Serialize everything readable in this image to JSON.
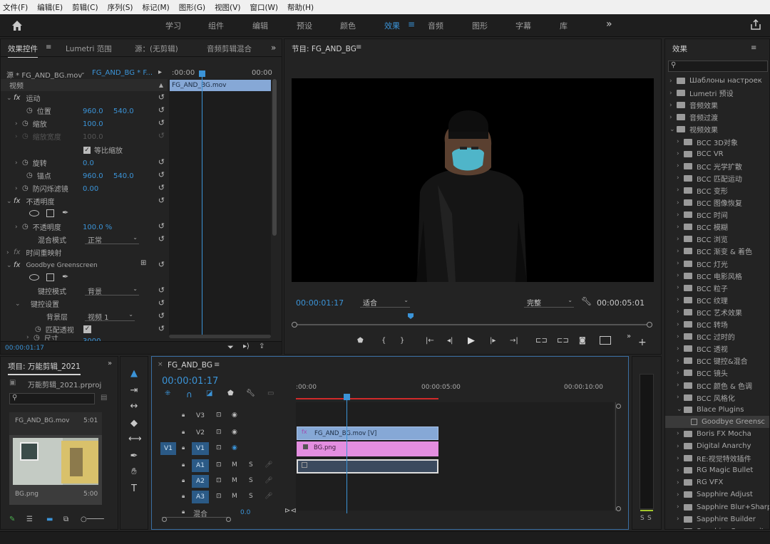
{
  "menu": [
    "文件(F)",
    "编辑(E)",
    "剪辑(C)",
    "序列(S)",
    "标记(M)",
    "图形(G)",
    "视图(V)",
    "窗口(W)",
    "帮助(H)"
  ],
  "workspaces": [
    "学习",
    "组件",
    "编辑",
    "预设",
    "颜色",
    "效果",
    "音频",
    "图形",
    "字幕",
    "库"
  ],
  "active_workspace": "效果",
  "effect_controls": {
    "tabs": [
      "效果控件",
      "Lumetri 范围",
      "源：(无剪辑)",
      "音频剪辑混合"
    ],
    "source_label": "源 * FG_AND_BG.mov",
    "seq_label": "FG_AND_BG * F...",
    "ruler_start": ":00:00",
    "ruler_end": "00:00",
    "clip_bar": "FG_AND_BG.mov",
    "video_label": "视频",
    "motion": "运动",
    "position": "位置",
    "pos_x": "960.0",
    "pos_y": "540.0",
    "scale": "缩放",
    "scale_val": "100.0",
    "scale_width": "缩放宽度",
    "scale_width_val": "100.0",
    "uniform_scale": "等比缩放",
    "rotation": "旋转",
    "rotation_val": "0.0",
    "anchor": "锚点",
    "anchor_x": "960.0",
    "anchor_y": "540.0",
    "anti_flicker": "防闪烁滤镜",
    "anti_flicker_val": "0.00",
    "opacity_section": "不透明度",
    "opacity": "不透明度",
    "opacity_val": "100.0 %",
    "blend_mode": "混合模式",
    "blend_val": "正常",
    "time_remap": "时间重映射",
    "goodbye": "Goodbye Greenscreen",
    "key_mode": "键控模式",
    "key_mode_val": "背景",
    "key_settings": "键控设置",
    "bg_layer": "背景层",
    "bg_layer_val": "视频 1",
    "match_persp": "匹配透视",
    "clipped_label": "尺寸",
    "clipped_val": "3000",
    "timecode": "00:00:01:17"
  },
  "program": {
    "title": "节目: FG_AND_BG",
    "timecode": "00:00:01:17",
    "fit": "适合",
    "quality": "完整",
    "duration": "00:00:05:01"
  },
  "effects_panel": {
    "title": "效果",
    "items": [
      {
        "label": "Шаблоны настроек",
        "level": 0,
        "open": false
      },
      {
        "label": "Lumetri 预设",
        "level": 0,
        "open": false
      },
      {
        "label": "音频效果",
        "level": 0,
        "open": false
      },
      {
        "label": "音频过渡",
        "level": 0,
        "open": false
      },
      {
        "label": "视频效果",
        "level": 0,
        "open": true
      },
      {
        "label": "BCC 3D对象",
        "level": 1,
        "open": false
      },
      {
        "label": "BCC VR",
        "level": 1,
        "open": false
      },
      {
        "label": "BCC 光学扩散",
        "level": 1,
        "open": false
      },
      {
        "label": "BCC 匹配运动",
        "level": 1,
        "open": false
      },
      {
        "label": "BCC 变形",
        "level": 1,
        "open": false
      },
      {
        "label": "BCC 图像恢复",
        "level": 1,
        "open": false
      },
      {
        "label": "BCC 时间",
        "level": 1,
        "open": false
      },
      {
        "label": "BCC 模糊",
        "level": 1,
        "open": false
      },
      {
        "label": "BCC 浏览",
        "level": 1,
        "open": false
      },
      {
        "label": "BCC 渐变 & 着色",
        "level": 1,
        "open": false
      },
      {
        "label": "BCC 灯光",
        "level": 1,
        "open": false
      },
      {
        "label": "BCC 电影风格",
        "level": 1,
        "open": false
      },
      {
        "label": "BCC 粒子",
        "level": 1,
        "open": false
      },
      {
        "label": "BCC 纹理",
        "level": 1,
        "open": false
      },
      {
        "label": "BCC 艺术效果",
        "level": 1,
        "open": false
      },
      {
        "label": "BCC 转场",
        "level": 1,
        "open": false
      },
      {
        "label": "BCC 过时的",
        "level": 1,
        "open": false
      },
      {
        "label": "BCC 透视",
        "level": 1,
        "open": false
      },
      {
        "label": "BCC 键控&混合",
        "level": 1,
        "open": false
      },
      {
        "label": "BCC 镜头",
        "level": 1,
        "open": false
      },
      {
        "label": "BCC 颜色 & 色调",
        "level": 1,
        "open": false
      },
      {
        "label": "BCC 风格化",
        "level": 1,
        "open": false
      },
      {
        "label": "Blace Plugins",
        "level": 1,
        "open": true
      },
      {
        "label": "Goodbye Greensc",
        "level": 2,
        "open": false
      },
      {
        "label": "Boris FX Mocha",
        "level": 1,
        "open": false
      },
      {
        "label": "Digital Anarchy",
        "level": 1,
        "open": false
      },
      {
        "label": "RE:视觉特效插件",
        "level": 1,
        "open": false
      },
      {
        "label": "RG Magic Bullet",
        "level": 1,
        "open": false
      },
      {
        "label": "RG VFX",
        "level": 1,
        "open": false
      },
      {
        "label": "Sapphire Adjust",
        "level": 1,
        "open": false
      },
      {
        "label": "Sapphire Blur+Sharp",
        "level": 1,
        "open": false
      },
      {
        "label": "Sapphire Builder",
        "level": 1,
        "open": false
      },
      {
        "label": "Sapphire Composite",
        "level": 1,
        "open": false
      }
    ]
  },
  "project": {
    "title": "项目: 万能剪辑_2021",
    "file": "万能剪辑_2021.prproj",
    "thumb1_name": "FG_AND_BG.mov",
    "thumb1_dur": "5:01",
    "thumb2_name": "BG.png",
    "thumb2_dur": "5:00"
  },
  "timeline": {
    "tab": "FG_AND_BG",
    "timecode": "00:00:01:17",
    "ruler": [
      ":00:00",
      "00:00:05:00",
      "00:00:10:00"
    ],
    "tracks_v": [
      "V3",
      "V2",
      "V1"
    ],
    "tracks_a": [
      "A1",
      "A2",
      "A3"
    ],
    "source_v": "V1",
    "master": "混合",
    "master_val": "0.0",
    "clip_v2": "FG_AND_BG.mov [V]",
    "clip_v1": "BG.png",
    "meter_s": "S"
  },
  "colors": {
    "accent": "#3b94d8",
    "clip_v2": "#86a8d6",
    "clip_v1": "#e48ee0",
    "clip_a1": "#3b4a5e",
    "render_bar": "#d12a2a"
  }
}
